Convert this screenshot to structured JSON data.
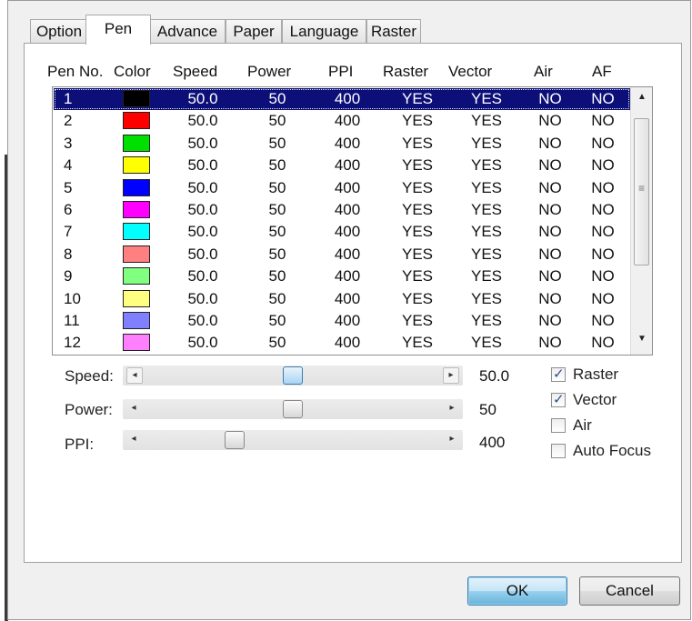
{
  "tabs": [
    {
      "label": "Option",
      "active": false
    },
    {
      "label": "Pen",
      "active": true
    },
    {
      "label": "Advance",
      "active": false
    },
    {
      "label": "Paper",
      "active": false
    },
    {
      "label": "Language",
      "active": false
    },
    {
      "label": "Raster",
      "active": false
    }
  ],
  "pen_table": {
    "columns": [
      "Pen No.",
      "Color",
      "Speed",
      "Power",
      "PPI",
      "Raster",
      "Vector",
      "Air",
      "AF"
    ],
    "selected_row": 0,
    "rows": [
      {
        "pen": "1",
        "color": "#000000",
        "speed": "50.0",
        "power": "50",
        "ppi": "400",
        "raster": "YES",
        "vector": "YES",
        "air": "NO",
        "af": "NO"
      },
      {
        "pen": "2",
        "color": "#ff0000",
        "speed": "50.0",
        "power": "50",
        "ppi": "400",
        "raster": "YES",
        "vector": "YES",
        "air": "NO",
        "af": "NO"
      },
      {
        "pen": "3",
        "color": "#00e000",
        "speed": "50.0",
        "power": "50",
        "ppi": "400",
        "raster": "YES",
        "vector": "YES",
        "air": "NO",
        "af": "NO"
      },
      {
        "pen": "4",
        "color": "#ffff00",
        "speed": "50.0",
        "power": "50",
        "ppi": "400",
        "raster": "YES",
        "vector": "YES",
        "air": "NO",
        "af": "NO"
      },
      {
        "pen": "5",
        "color": "#0000ff",
        "speed": "50.0",
        "power": "50",
        "ppi": "400",
        "raster": "YES",
        "vector": "YES",
        "air": "NO",
        "af": "NO"
      },
      {
        "pen": "6",
        "color": "#ff00ff",
        "speed": "50.0",
        "power": "50",
        "ppi": "400",
        "raster": "YES",
        "vector": "YES",
        "air": "NO",
        "af": "NO"
      },
      {
        "pen": "7",
        "color": "#00ffff",
        "speed": "50.0",
        "power": "50",
        "ppi": "400",
        "raster": "YES",
        "vector": "YES",
        "air": "NO",
        "af": "NO"
      },
      {
        "pen": "8",
        "color": "#ff8080",
        "speed": "50.0",
        "power": "50",
        "ppi": "400",
        "raster": "YES",
        "vector": "YES",
        "air": "NO",
        "af": "NO"
      },
      {
        "pen": "9",
        "color": "#80ff80",
        "speed": "50.0",
        "power": "50",
        "ppi": "400",
        "raster": "YES",
        "vector": "YES",
        "air": "NO",
        "af": "NO"
      },
      {
        "pen": "10",
        "color": "#ffff80",
        "speed": "50.0",
        "power": "50",
        "ppi": "400",
        "raster": "YES",
        "vector": "YES",
        "air": "NO",
        "af": "NO"
      },
      {
        "pen": "11",
        "color": "#8080ff",
        "speed": "50.0",
        "power": "50",
        "ppi": "400",
        "raster": "YES",
        "vector": "YES",
        "air": "NO",
        "af": "NO"
      },
      {
        "pen": "12",
        "color": "#ff80ff",
        "speed": "50.0",
        "power": "50",
        "ppi": "400",
        "raster": "YES",
        "vector": "YES",
        "air": "NO",
        "af": "NO"
      }
    ],
    "scrollbar_icons": [
      "scroll-up-icon",
      "scroll-grip-icon",
      "scroll-down-icon"
    ]
  },
  "sliders": {
    "speed": {
      "label": "Speed:",
      "value": "50.0",
      "position": 0.5
    },
    "power": {
      "label": "Power:",
      "value": "50",
      "position": 0.5
    },
    "ppi": {
      "label": "PPI:",
      "value": "400",
      "position": 0.29
    }
  },
  "checkboxes": {
    "raster": {
      "label": "Raster",
      "checked": true
    },
    "vector": {
      "label": "Vector",
      "checked": true
    },
    "air": {
      "label": "Air",
      "checked": false
    },
    "auto_focus": {
      "label": "Auto Focus",
      "checked": false
    }
  },
  "buttons": {
    "ok": "OK",
    "cancel": "Cancel"
  }
}
